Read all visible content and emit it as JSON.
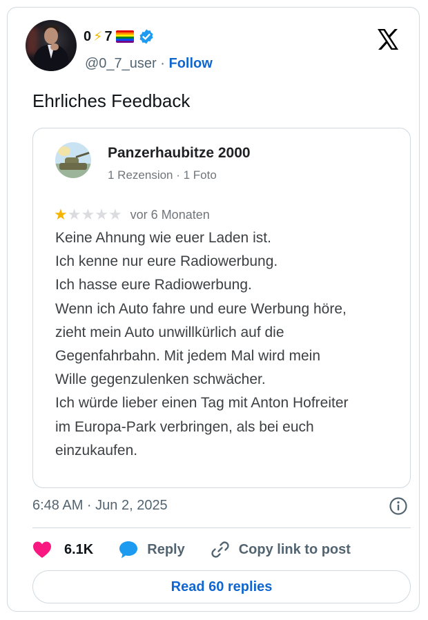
{
  "author": {
    "display_name_prefix": "0",
    "display_name_bolt": "⚡",
    "display_name_suffix": "7",
    "handle": "@0_7_user",
    "separator": "·",
    "follow_label": "Follow"
  },
  "icons": {
    "verified": "verified-badge-icon",
    "logo": "x-logo-icon",
    "like": "heart-icon",
    "reply": "speech-bubble-icon",
    "copy": "link-icon",
    "info": "info-icon"
  },
  "colors": {
    "link_blue": "#0f66d0",
    "like_pink": "#f91880",
    "verified_blue": "#1d9bf0",
    "star_gold": "#f4b400"
  },
  "tweet": {
    "text": "Ehrliches Feedback",
    "timestamp": "6:48 AM · Jun 2, 2025"
  },
  "review": {
    "reviewer_name": "Panzerhaubitze 2000",
    "reviewer_meta": "1 Rezension · 1 Foto",
    "rating": 1,
    "rating_max": 5,
    "time_ago": "vor 6 Monaten",
    "lines": [
      "Keine Ahnung wie euer Laden ist.",
      "Ich kenne nur eure Radiowerbung.",
      "Ich hasse eure Radiowerbung.",
      "Wenn ich Auto fahre und eure Werbung höre,",
      "zieht mein Auto unwillkürlich auf die",
      "Gegenfahrbahn. Mit jedem Mal wird mein",
      "Wille gegenzulenken schwächer.",
      "Ich würde lieber einen Tag mit Anton Hofreiter",
      "im Europa-Park verbringen, als bei euch",
      "einzukaufen."
    ]
  },
  "actions": {
    "likes_count": "6.1K",
    "reply_label": "Reply",
    "copy_label": "Copy link to post",
    "read_replies_label": "Read 60 replies"
  }
}
